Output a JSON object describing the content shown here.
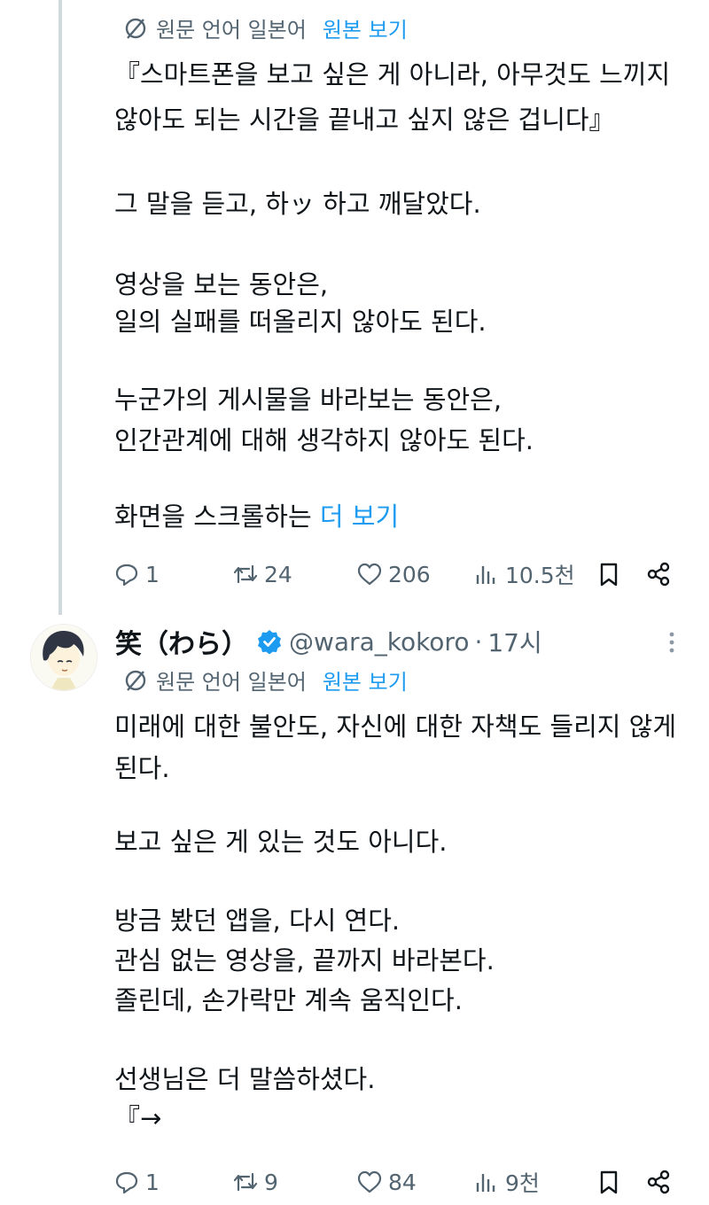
{
  "post1": {
    "translation": {
      "label": "원문 언어 일본어",
      "view_original": "원본 보기"
    },
    "lines": [
      "『스마트폰을 보고 싶은 게 아니라, 아무것도 느끼지",
      "않아도 되는 시간을 끝내고 싶지 않은 겁니다』",
      "그 말을 듣고, 하ッ 하고 깨달았다.",
      "영상을 보는 동안은,",
      "일의 실패를 떠올리지 않아도 된다.",
      "누군가의 게시물을 바라보는 동안은,",
      "인간관계에 대해 생각하지 않아도 된다.",
      "화면을 스크롤하는"
    ],
    "show_more": "더 보기",
    "actions": {
      "replies": "1",
      "reposts": "24",
      "likes": "206",
      "views": "10.5천"
    }
  },
  "post2": {
    "display_name": "笑（わら）",
    "handle": "@wara_kokoro",
    "separator": "·",
    "time": "17시",
    "translation": {
      "label": "원문 언어 일본어",
      "view_original": "원본 보기"
    },
    "lines": [
      "미래에 대한 불안도, 자신에 대한 자책도 들리지 않게",
      "된다.",
      "보고 싶은 게 있는 것도 아니다.",
      "방금 봤던 앱을, 다시 연다.",
      "관심 없는 영상을, 끝까지 바라본다.",
      "졸린데, 손가락만 계속 움직인다.",
      "선생님은 더 말씀하셨다.",
      "『→"
    ],
    "actions": {
      "replies": "1",
      "reposts": "9",
      "likes": "84",
      "views": "9천"
    }
  },
  "colors": {
    "accent": "#1d9bf0",
    "muted": "#536471",
    "text": "#0f1419",
    "thread_line": "#cfd9de"
  },
  "icons": [
    "translate-icon",
    "reply-icon",
    "repost-icon",
    "like-icon",
    "views-icon",
    "bookmark-icon",
    "share-icon",
    "verified-badge-icon",
    "more-icon"
  ]
}
